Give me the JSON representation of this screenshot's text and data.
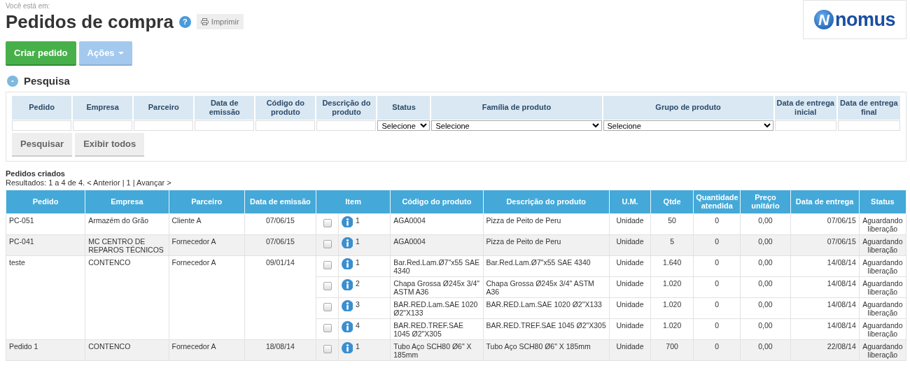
{
  "breadcrumb": "Você está em:",
  "title": "Pedidos de compra",
  "help": "?",
  "print_button": "Imprimir",
  "logo": {
    "mark": "N",
    "text": "nomus"
  },
  "actions": [
    {
      "label": "Criar pedido",
      "kind": "primary"
    },
    {
      "label": "Ações",
      "kind": "dropdown"
    }
  ],
  "search": {
    "toggle": "-",
    "title": "Pesquisa",
    "fields": [
      {
        "label": "Pedido",
        "kind": "text"
      },
      {
        "label": "Empresa",
        "kind": "text"
      },
      {
        "label": "Parceiro",
        "kind": "text"
      },
      {
        "label": "Data de emissão",
        "kind": "text"
      },
      {
        "label": "Código do produto",
        "kind": "text"
      },
      {
        "label": "Descrição do produto",
        "kind": "text"
      },
      {
        "label": "Status",
        "kind": "select",
        "value": "Selecione"
      },
      {
        "label": "Família de produto",
        "kind": "select",
        "value": "Selecione"
      },
      {
        "label": "Grupo de produto",
        "kind": "select",
        "value": "Selecione"
      },
      {
        "label": "Data de entrega inicial",
        "kind": "text"
      },
      {
        "label": "Data de entrega final",
        "kind": "text"
      }
    ],
    "buttons": [
      "Pesquisar",
      "Exibir todos"
    ]
  },
  "results": {
    "title": "Pedidos criados",
    "summary": "Resultados: 1 a 4 de 4. < Anterior | 1 | Avançar >",
    "columns": [
      "Pedido",
      "Empresa",
      "Parceiro",
      "Data de emissão",
      "Item",
      "Código do produto",
      "Descrição do produto",
      "U.M.",
      "Qtde",
      "Quantidade atendida",
      "Preço unitário",
      "Data de entrega",
      "Status"
    ],
    "orders": [
      {
        "pedido": "PC-051",
        "empresa": "Armazém do Grão",
        "parceiro": "Cliente A",
        "data_emissao": "07/06/15",
        "items": [
          {
            "checked": false,
            "item": "1",
            "codigo": "AGA0004",
            "descricao": "Pizza de Peito de Peru",
            "um": "Unidade",
            "qtde": "50",
            "qtd_atendida": "0",
            "preco": "0,00",
            "data_entrega": "07/06/15",
            "status": "Aguardando liberação"
          }
        ]
      },
      {
        "pedido": "PC-041",
        "empresa": "MC CENTRO DE REPAROS TÉCNICOS",
        "parceiro": "Fornecedor A",
        "data_emissao": "07/06/15",
        "items": [
          {
            "checked": false,
            "item": "1",
            "codigo": "AGA0004",
            "descricao": "Pizza de Peito de Peru",
            "um": "Unidade",
            "qtde": "5",
            "qtd_atendida": "0",
            "preco": "0,00",
            "data_entrega": "07/06/15",
            "status": "Aguardando liberação"
          }
        ]
      },
      {
        "pedido": "teste",
        "empresa": "CONTENCO",
        "parceiro": "Fornecedor A",
        "data_emissao": "09/01/14",
        "items": [
          {
            "checked": false,
            "item": "1",
            "codigo": "Bar.Red.Lam.Ø7\"x55 SAE 4340",
            "descricao": "Bar.Red.Lam.Ø7\"x55 SAE 4340",
            "um": "Unidade",
            "qtde": "1.640",
            "qtd_atendida": "0",
            "preco": "0,00",
            "data_entrega": "14/08/14",
            "status": "Aguardando liberação"
          },
          {
            "checked": false,
            "item": "2",
            "codigo": "Chapa Grossa Ø245x 3/4\" ASTM A36",
            "descricao": "Chapa Grossa Ø245x 3/4\" ASTM A36",
            "um": "Unidade",
            "qtde": "1.020",
            "qtd_atendida": "0",
            "preco": "0,00",
            "data_entrega": "14/08/14",
            "status": "Aguardando liberação"
          },
          {
            "checked": false,
            "item": "3",
            "codigo": "BAR.RED.Lam.SAE 1020 Ø2\"X133",
            "descricao": "BAR.RED.Lam.SAE 1020 Ø2\"X133",
            "um": "Unidade",
            "qtde": "1.020",
            "qtd_atendida": "0",
            "preco": "0,00",
            "data_entrega": "14/08/14",
            "status": "Aguardando liberação"
          },
          {
            "checked": false,
            "item": "4",
            "codigo": "BAR.RED.TREF.SAE 1045 Ø2\"X305",
            "descricao": "BAR.RED.TREF.SAE 1045 Ø2\"X305",
            "um": "Unidade",
            "qtde": "1.020",
            "qtd_atendida": "0",
            "preco": "0,00",
            "data_entrega": "14/08/14",
            "status": "Aguardando liberação"
          }
        ]
      },
      {
        "pedido": "Pedido 1",
        "empresa": "CONTENCO",
        "parceiro": "Fornecedor A",
        "data_emissao": "18/08/14",
        "items": [
          {
            "checked": false,
            "item": "1",
            "codigo": "Tubo Aço SCH80 Ø6\" X 185mm",
            "descricao": "Tubo Aço SCH80 Ø6\" X 185mm",
            "um": "Unidade",
            "qtde": "700",
            "qtd_atendida": "0",
            "preco": "0,00",
            "data_entrega": "22/08/14",
            "status": "Aguardando liberação"
          }
        ]
      }
    ]
  }
}
